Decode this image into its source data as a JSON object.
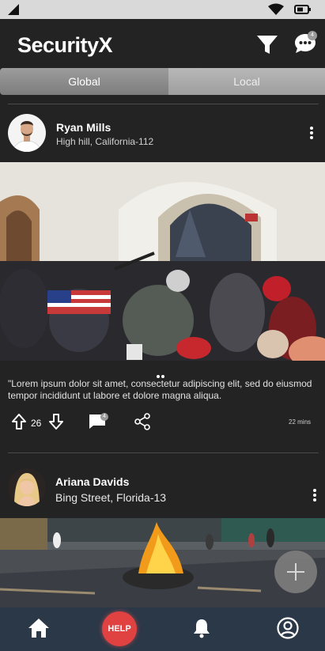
{
  "app": {
    "title": "SecurityX",
    "notifications_count": "4"
  },
  "tabs": [
    {
      "label": "Global"
    },
    {
      "label": "Local"
    }
  ],
  "posts": [
    {
      "author": "Ryan Mills",
      "location": "High hill, California-112",
      "caption": "\"Lorem ipsum dolor sit amet, consectetur adipiscing elit, sed do eiusmod tempor incididunt ut labore et dolore magna aliqua.",
      "votes": "26",
      "comments_count": "4",
      "time": "22 mins"
    },
    {
      "author": "Ariana Davids",
      "location": "Bing Street, Florida-13"
    }
  ],
  "nav": {
    "help_label": "HELP"
  },
  "colors": {
    "background": "#232323",
    "bottom_nav": "#2b3848",
    "help_button": "#e04242"
  }
}
